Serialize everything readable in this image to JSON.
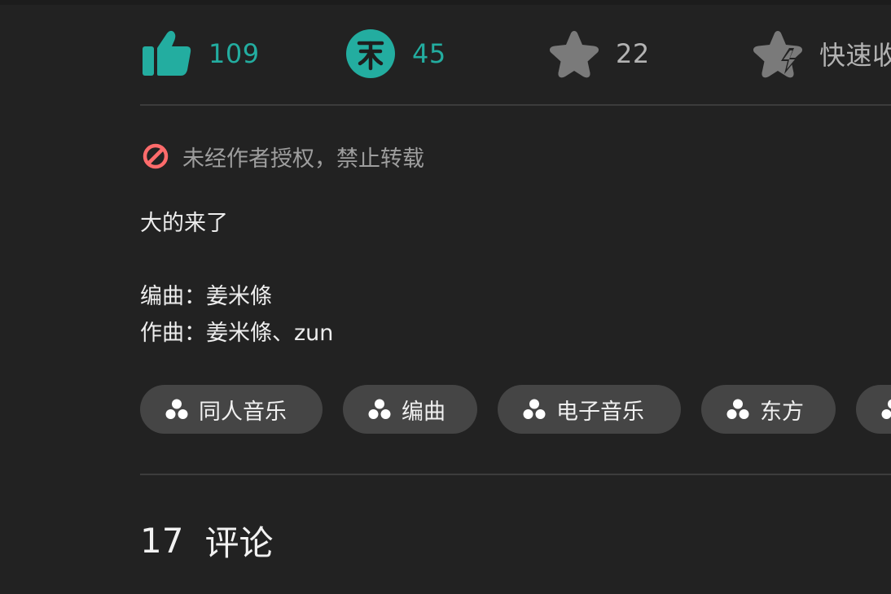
{
  "actions": {
    "like": {
      "count": "109",
      "icon": "thumbs-up-icon",
      "color": "#23ada0"
    },
    "coin": {
      "count": "45",
      "icon": "coin-icon",
      "color": "#23ada0"
    },
    "favorite": {
      "count": "22",
      "icon": "star-icon",
      "color": "#7a7a7a"
    },
    "triple": {
      "label": "快速收",
      "icon": "lightning-star-icon",
      "color": "#7a7a7a"
    }
  },
  "copyright": {
    "icon": "no-repost-icon",
    "text": "未经作者授权，禁止转载",
    "icon_color": "#ff6b6b"
  },
  "description": {
    "line1": "大的来了",
    "line2": "编曲：姜米條",
    "line3": "作曲：姜米條、zun"
  },
  "tags": [
    {
      "label": "同人音乐",
      "icon": "channel-icon"
    },
    {
      "label": "编曲",
      "icon": "channel-icon"
    },
    {
      "label": "电子音乐",
      "icon": "channel-icon"
    },
    {
      "label": "东方",
      "icon": "channel-icon"
    },
    {
      "label": "",
      "icon": "channel-icon"
    }
  ],
  "comments": {
    "count": "17",
    "label": "评论"
  }
}
